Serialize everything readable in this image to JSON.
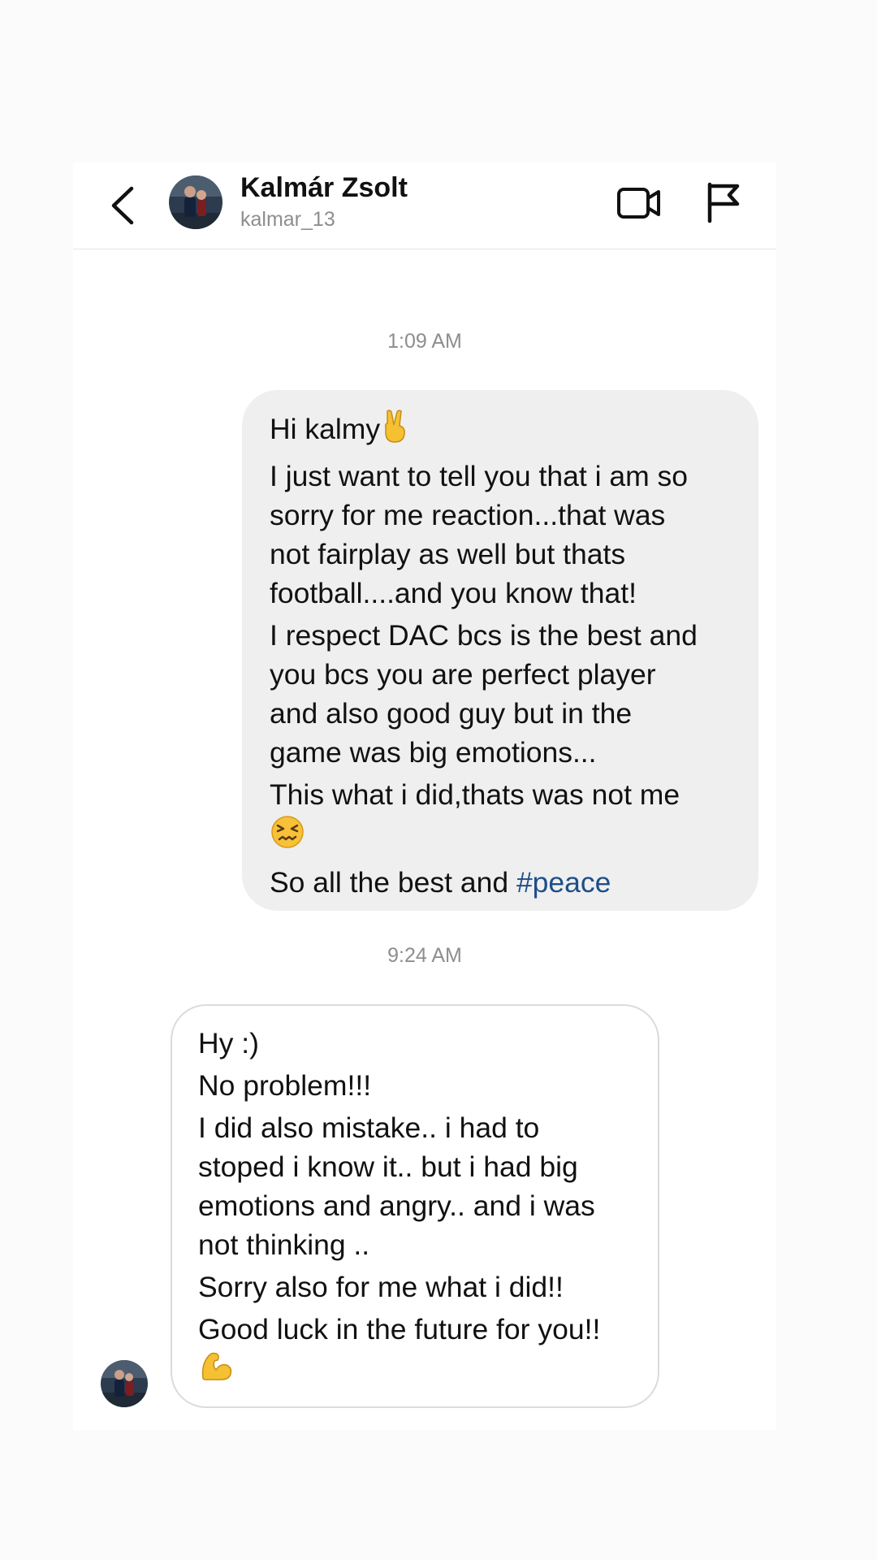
{
  "header": {
    "contact_name": "Kalmár Zsolt",
    "contact_handle": "kalmar_13",
    "back_icon": "chevron-left-icon",
    "video_icon": "video-camera-icon",
    "flag_icon": "flag-icon"
  },
  "messages": [
    {
      "timestamp": "1:09 AM",
      "direction": "sent",
      "lines": [
        "Hi kalmy",
        "I just want to tell you that i am so",
        "sorry for me reaction...that was",
        "not fairplay as well but thats",
        "football....and you know that!",
        "I respect DAC bcs is the best and",
        "you bcs you are perfect player",
        "and also good guy but in the",
        "game was big emotions...",
        "This what i did,thats was not me",
        "So all the best and ",
        "#peace"
      ],
      "emojis": [
        "victory-hand-emoji",
        "confounded-face-emoji"
      ]
    },
    {
      "timestamp": "9:24 AM",
      "direction": "received",
      "lines": [
        "Hy :)",
        "No problem!!!",
        "I did also mistake.. i had to",
        "stoped i know it.. but i had big",
        "emotions and angry..  and i was",
        "not thinking ..",
        "Sorry also for me what i did!!",
        "Good luck in the future for you!!"
      ],
      "emojis": [
        "flexed-biceps-emoji"
      ]
    }
  ],
  "colors": {
    "sent_bubble": "#efefef",
    "received_border": "#dbdbdb",
    "hashtag": "#1e4f87",
    "secondary_text": "#8e8e8e"
  }
}
